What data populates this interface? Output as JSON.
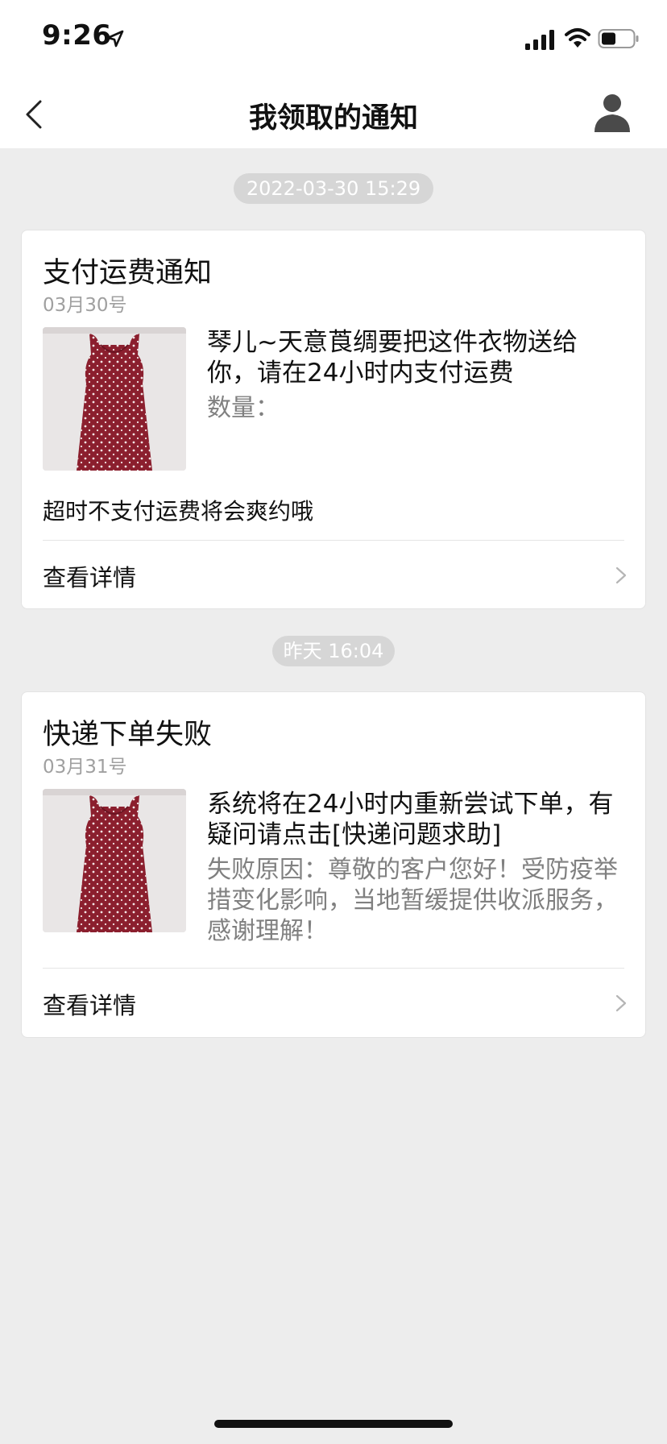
{
  "status_bar": {
    "time": "9:26",
    "icons": [
      "location-arrow-icon",
      "signal-icon",
      "wifi-icon",
      "battery-icon"
    ]
  },
  "nav": {
    "title": "我领取的通知",
    "back_icon": "chevron-left-icon",
    "profile_icon": "user-icon"
  },
  "notifications": [
    {
      "timestamp": "2022-03-30 15:29",
      "title": "支付运费通知",
      "date": "03月30号",
      "thumbnail": "red-polka-dot-dress",
      "message": "琴儿~天意莨绸要把这件衣物送给你，请在24小时内支付运费",
      "sub": "数量：",
      "note": "超时不支付运费将会爽约哦",
      "detail_label": "查看详情"
    },
    {
      "timestamp": "昨天 16:04",
      "title": "快递下单失败",
      "date": "03月31号",
      "thumbnail": "red-polka-dot-dress",
      "message": "系统将在24小时内重新尝试下单，有疑问请点击[快递问题求助]",
      "sub": "失败原因：尊敬的客户您好！受防疫举措变化影响，当地暂缓提供收派服务，感谢理解！",
      "detail_label": "查看详情"
    }
  ],
  "colors": {
    "background": "#ededed",
    "card": "#ffffff",
    "pill": "#d6d6d6",
    "secondary_text": "#808080",
    "dress": "#8b1f2e"
  }
}
